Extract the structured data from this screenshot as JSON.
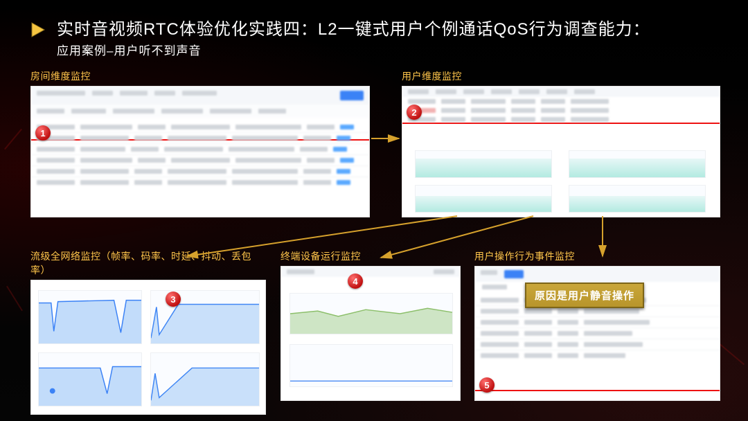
{
  "title": {
    "main": "实时音视频RTC体验优化实践四：L2一键式用户个例通话QoS行为调查能力：",
    "sub": "应用案例–用户听不到声音"
  },
  "panels": {
    "room": {
      "title": "房间维度监控",
      "badge": "1"
    },
    "user": {
      "title": "用户维度监控",
      "badge": "2"
    },
    "network": {
      "title": "流级全网络监控（帧率、码率、时延、抖动、丢包率）",
      "badge": "3"
    },
    "device": {
      "title": "终端设备运行监控",
      "badge": "4"
    },
    "events": {
      "title": "用户操作行为事件监控",
      "badge": "5"
    }
  },
  "annotation": {
    "text": "原因是用户静音操作"
  },
  "colors": {
    "accent": "#ffc64b",
    "badge": "#c01010",
    "arrow": "#d6a12c",
    "redline": "#ee1111"
  }
}
